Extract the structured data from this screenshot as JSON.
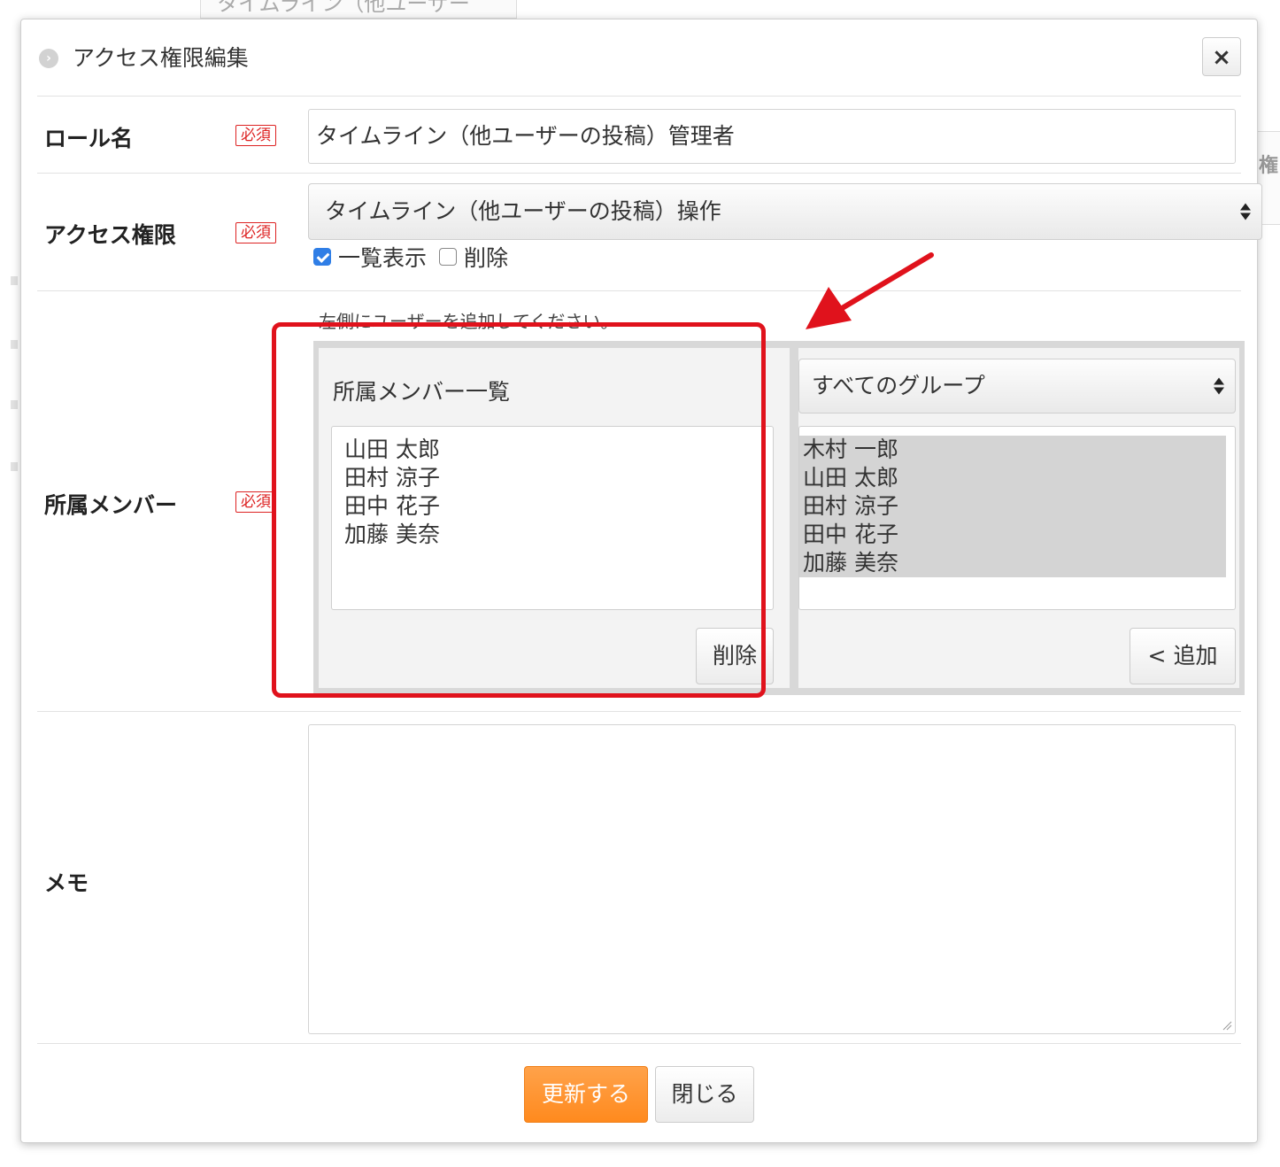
{
  "background": {
    "top_select_fragment": "タイムライン（他ユーザー",
    "right_edge_fragment": "権"
  },
  "dialog": {
    "title": "アクセス権限編集",
    "close_label": "×"
  },
  "form": {
    "required_badge": "必須",
    "role_name": {
      "label": "ロール名",
      "value": "タイムライン（他ユーザーの投稿）管理者"
    },
    "access": {
      "label": "アクセス権限",
      "selected": "タイムライン（他ユーザーの投稿）操作",
      "options": [
        {
          "label": "一覧表示",
          "checked": true
        },
        {
          "label": "削除",
          "checked": false
        }
      ]
    },
    "members": {
      "label": "所属メンバー",
      "hint": "左側にユーザーを追加してください。",
      "left_title": "所属メンバー一覧",
      "left_list": [
        "山田 太郎",
        "田村 涼子",
        "田中 花子",
        "加藤 美奈"
      ],
      "remove_button": "削除",
      "group_select": "すべてのグループ",
      "right_list": [
        "木村 一郎",
        "山田 太郎",
        "田村 涼子",
        "田中 花子",
        "加藤 美奈"
      ],
      "add_button": "< 追加"
    },
    "memo": {
      "label": "メモ",
      "value": ""
    }
  },
  "footer": {
    "update_button": "更新する",
    "close_button": "閉じる"
  },
  "colors": {
    "accent_orange": "#ff8a1e",
    "highlight_red": "#e0121c",
    "required_red": "#dd2222",
    "checkbox_blue": "#2f7ee6"
  }
}
